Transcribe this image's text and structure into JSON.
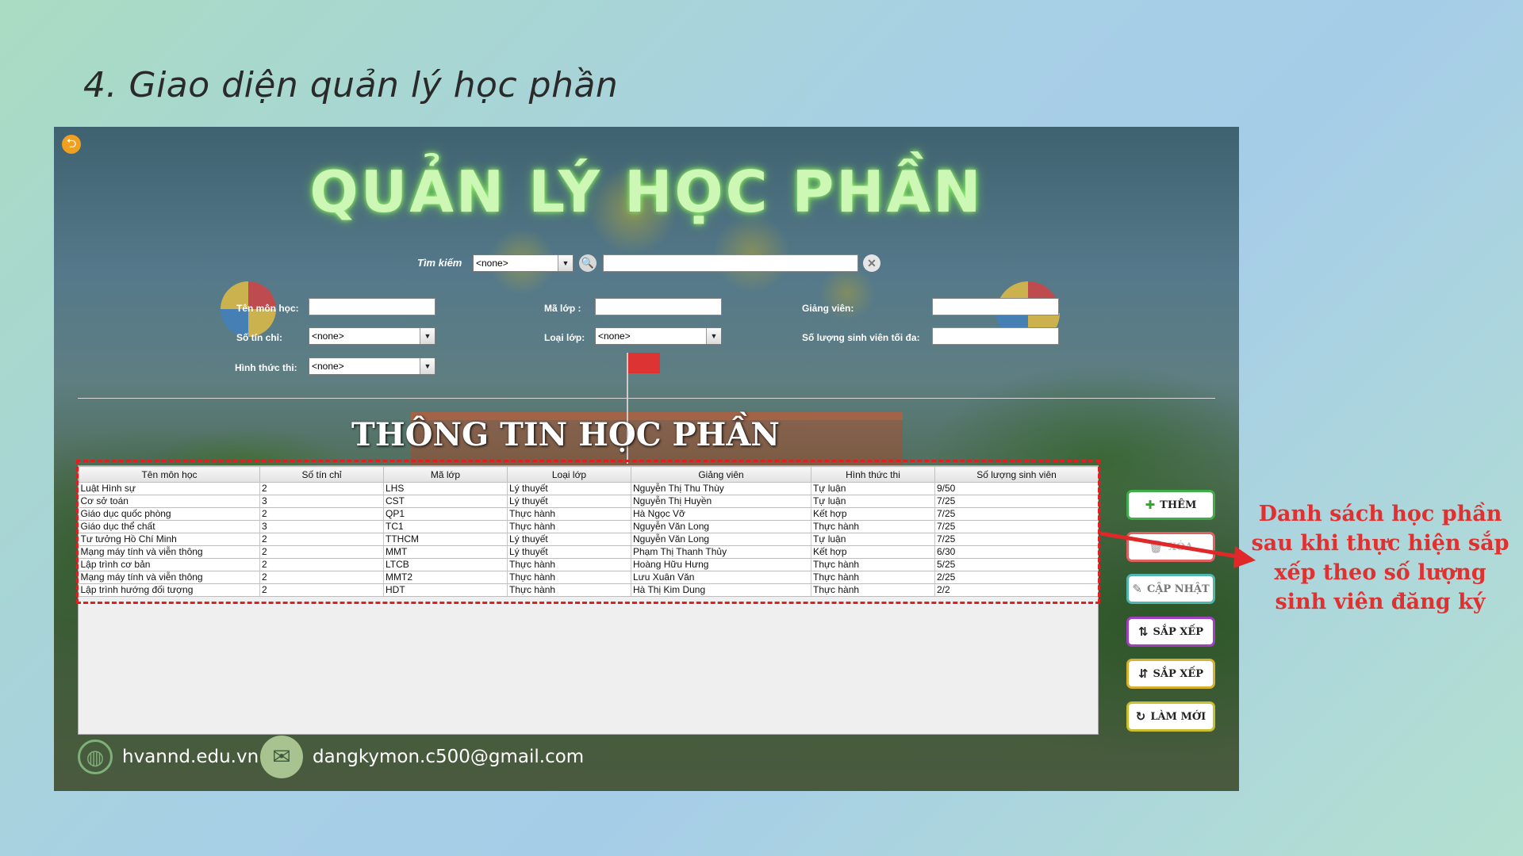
{
  "slide_title": "4. Giao diện quản lý học phần",
  "app": {
    "title": "QUẢN LÝ HỌC PHẦN",
    "search": {
      "label": "Tìm kiếm",
      "selected": "<none>",
      "value": ""
    },
    "form": {
      "course_name_label": "Tên môn học:",
      "credits_label": "Số tín chỉ:",
      "credits_selected": "<none>",
      "exam_type_label": "Hình thức thi:",
      "exam_type_selected": "<none>",
      "class_code_label": "Mã lớp :",
      "class_type_label": "Loại lớp:",
      "class_type_selected": "<none>",
      "lecturer_label": "Giảng viên:",
      "max_students_label": "Số lượng sinh viên tối đa:"
    },
    "section_title": "THÔNG TIN HỌC PHẦN",
    "table": {
      "headers": [
        "Tên môn học",
        "Số tín chỉ",
        "Mã lớp",
        "Loại lớp",
        "Giảng viên",
        "Hình thức thi",
        "Số lượng sinh viên"
      ],
      "rows": [
        [
          "Luật Hình sự",
          "2",
          "LHS",
          "Lý thuyết",
          "Nguyễn Thị Thu Thùy",
          "Tự luận",
          "9/50"
        ],
        [
          "Cơ sở toán",
          "3",
          "CST",
          "Lý thuyết",
          "Nguyễn Thị Huyền",
          "Tự luận",
          "7/25"
        ],
        [
          "Giáo dục quốc phòng",
          "2",
          "QP1",
          "Thực hành",
          "Hà Ngọc Vỡ",
          "Kết hợp",
          "7/25"
        ],
        [
          "Giáo dục thể chất",
          "3",
          "TC1",
          "Thực hành",
          "Nguyễn Văn Long",
          "Thực hành",
          "7/25"
        ],
        [
          "Tư tưởng Hồ Chí Minh",
          "2",
          "TTHCM",
          "Lý thuyết",
          "Nguyễn Văn Long",
          "Tự luận",
          "7/25"
        ],
        [
          "Mạng máy tính và viễn thông",
          "2",
          "MMT",
          "Lý thuyết",
          "Phạm Thị Thanh Thủy",
          "Kết hợp",
          "6/30"
        ],
        [
          "Lập trình cơ bản",
          "2",
          "LTCB",
          "Thực hành",
          "Hoàng Hữu Hưng",
          "Thực hành",
          "5/25"
        ],
        [
          "Mạng máy tính và viễn thông",
          "2",
          "MMT2",
          "Thực hành",
          "Lưu Xuân Văn",
          "Thực hành",
          "2/25"
        ],
        [
          "Lập trình hướng đối tượng",
          "2",
          "HDT",
          "Thực hành",
          "Hà Thị Kim Dung",
          "Thực hành",
          "2/2"
        ]
      ]
    },
    "buttons": {
      "add": "THÊM",
      "delete": "XÓA",
      "update": "CẬP NHẬT",
      "sort_asc": "SẮP XẾP",
      "sort_desc": "SẮP XẾP",
      "refresh": "LÀM MỚI"
    },
    "footer": {
      "website": "hvannd.edu.vn",
      "email": "dangkymon.c500@gmail.com"
    }
  },
  "annotation": "Danh sách học phần sau khi thực hiện sắp xếp theo số lượng sinh viên đăng ký",
  "colors": {
    "annotation": "#e03030",
    "title_glow": "#cdf7b4",
    "add_border": "#3fae4a"
  }
}
